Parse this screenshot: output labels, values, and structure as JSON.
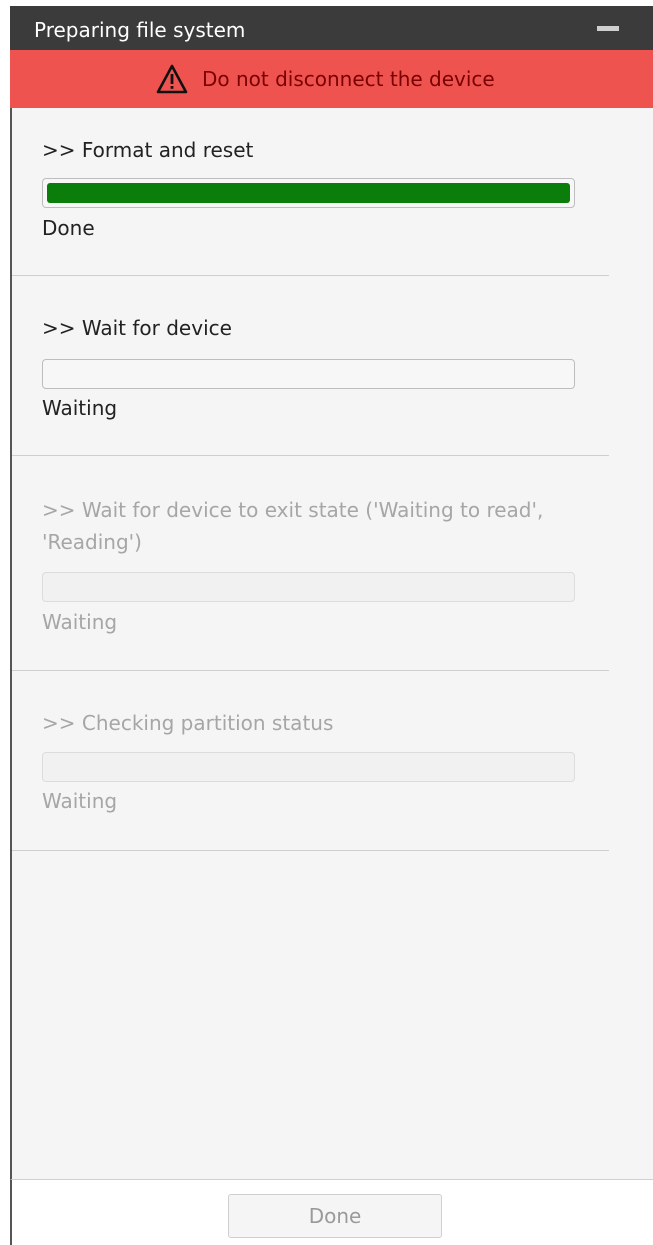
{
  "window": {
    "title": "Preparing file system"
  },
  "warning": {
    "icon": "warning-triangle-icon",
    "text": "Do not disconnect the device",
    "color": "#ef5350"
  },
  "steps": [
    {
      "label": ">> Format and reset",
      "status": "Done",
      "progress": 1.0,
      "enabled": true
    },
    {
      "label": ">> Wait for device",
      "status": "Waiting",
      "progress": 0.0,
      "enabled": true
    },
    {
      "label": ">> Wait for device to exit state ('Waiting to read',\n'Reading')",
      "status": "Waiting",
      "progress": 0.0,
      "enabled": false
    },
    {
      "label": ">> Checking partition status",
      "status": "Waiting",
      "progress": 0.0,
      "enabled": false
    }
  ],
  "footer": {
    "done_label": "Done",
    "done_enabled": false
  },
  "colors": {
    "titlebar": "#3b3b3b",
    "progress_fill": "#0a7d0a",
    "background": "#f5f5f5"
  }
}
